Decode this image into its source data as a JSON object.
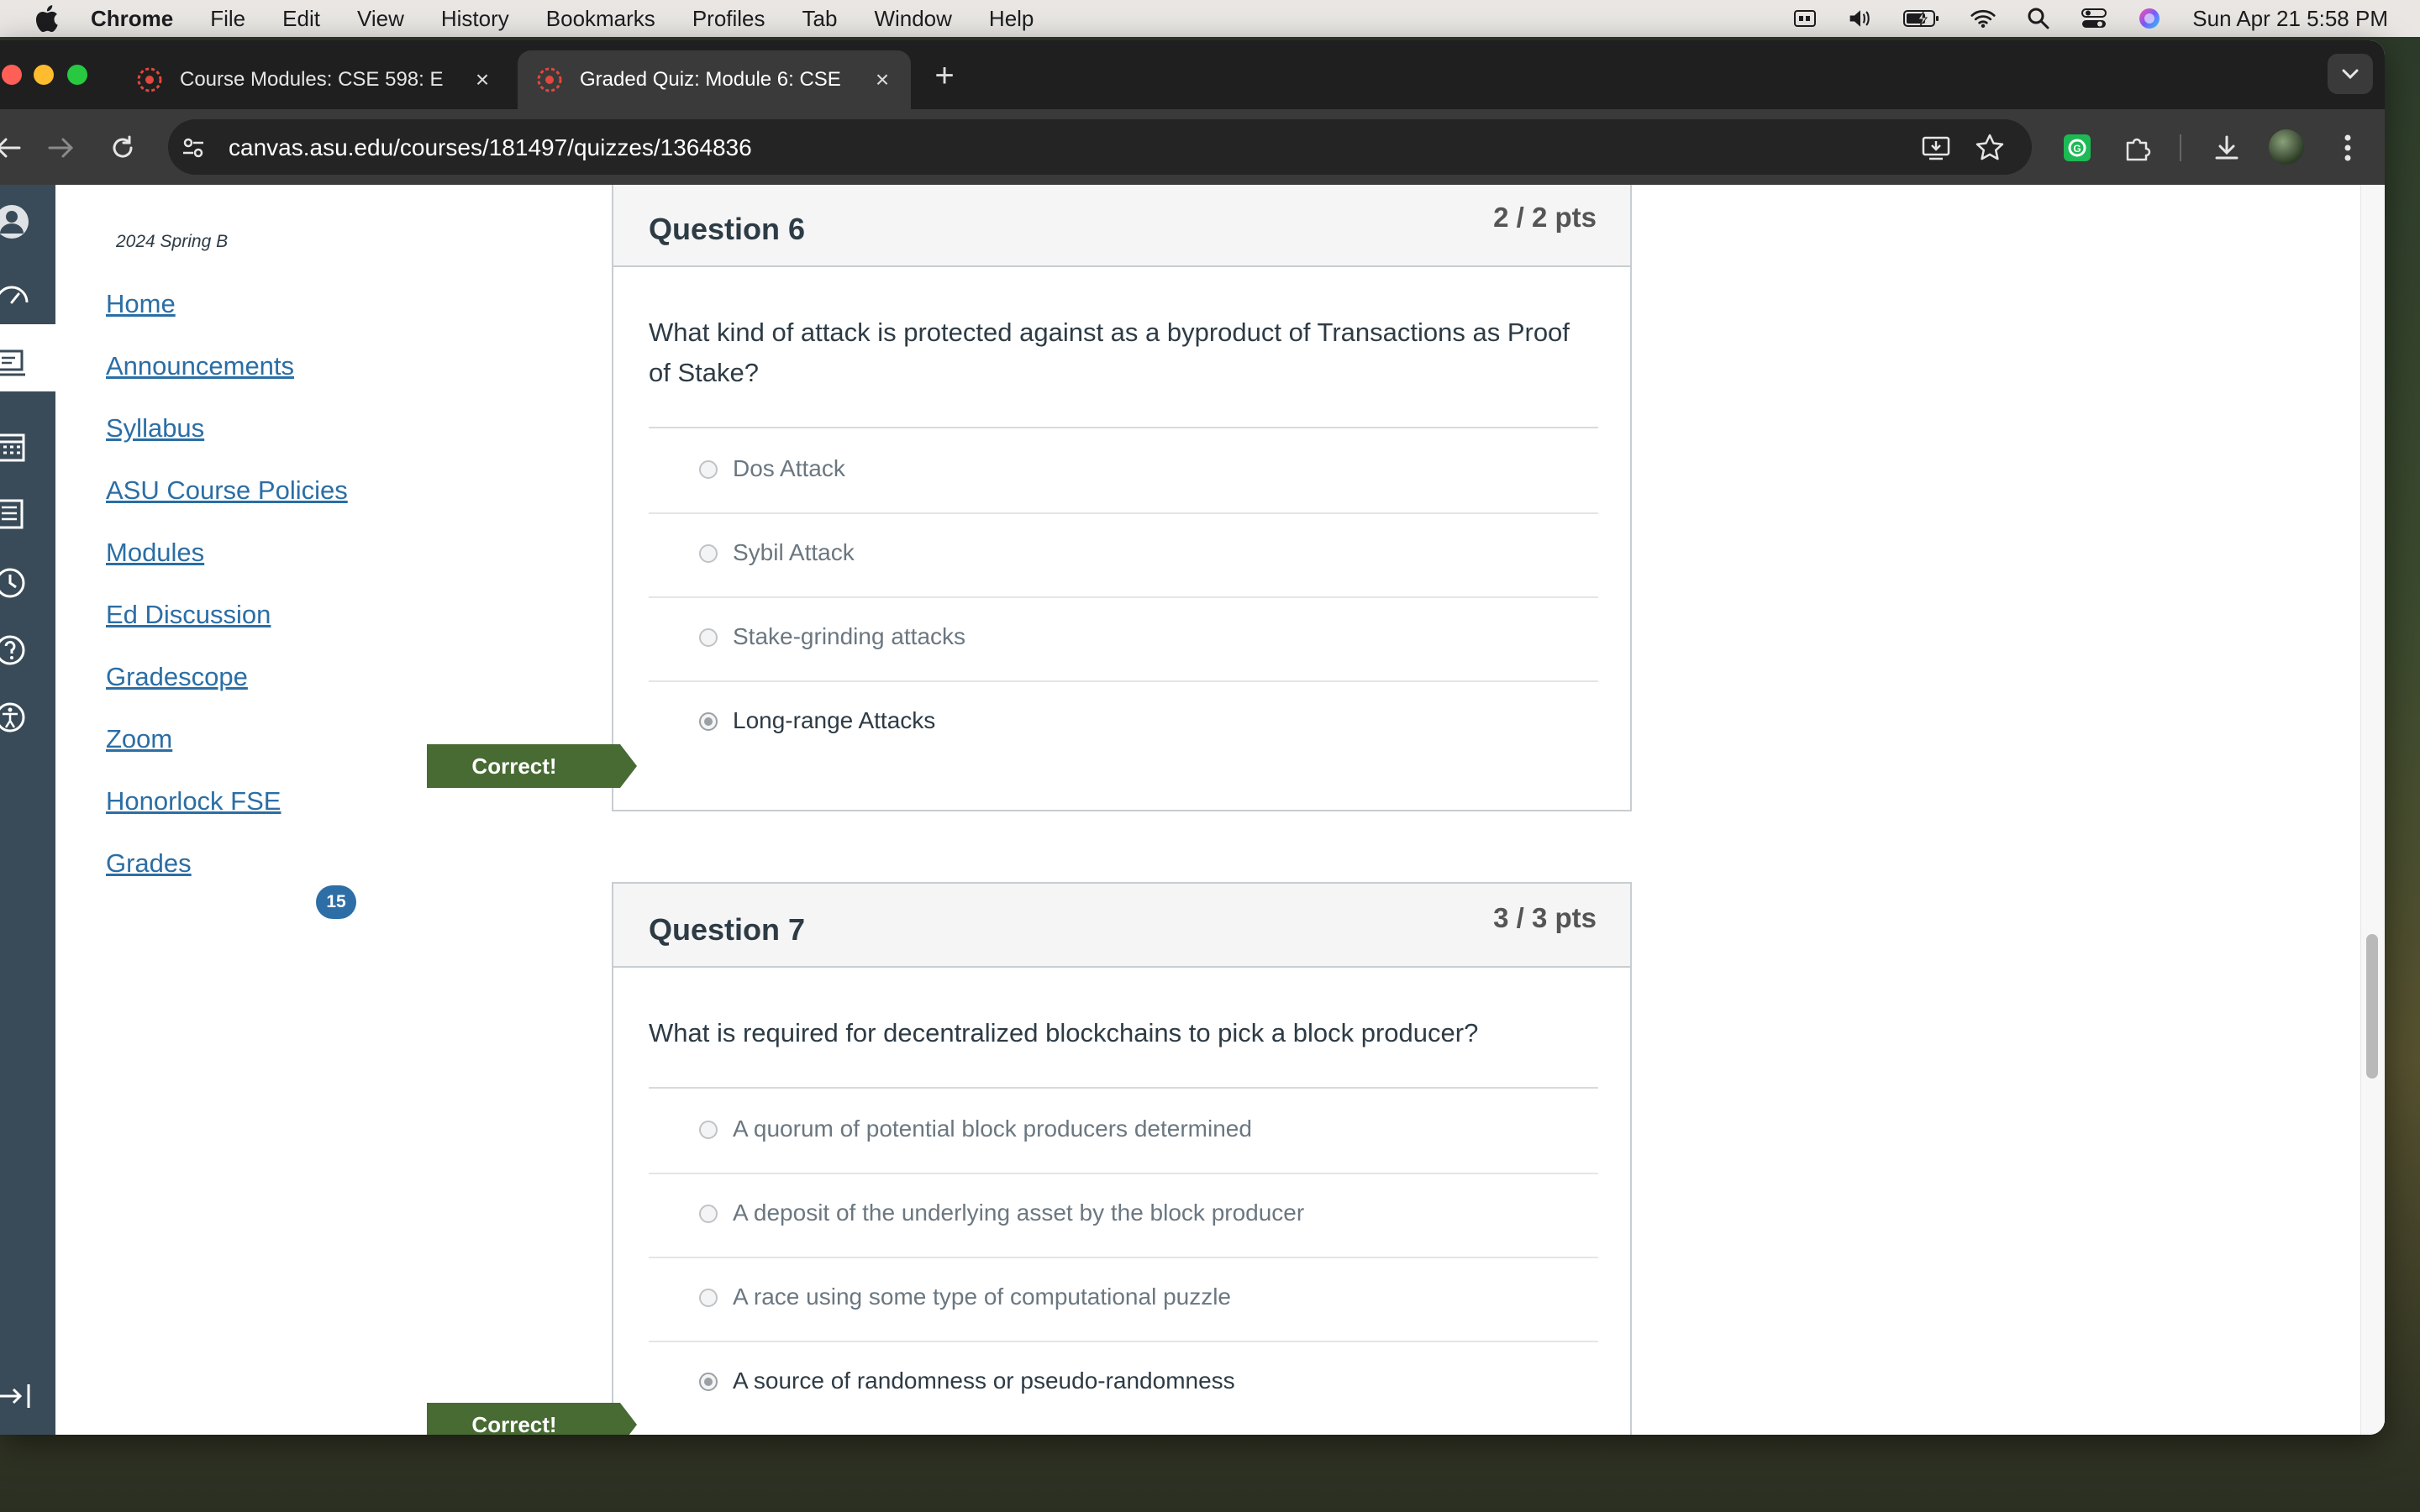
{
  "menubar": {
    "app_name": "Chrome",
    "menus": [
      "File",
      "Edit",
      "View",
      "History",
      "Bookmarks",
      "Profiles",
      "Tab",
      "Window",
      "Help"
    ],
    "clock": "Sun Apr 21  5:58 PM"
  },
  "browser": {
    "tabs": [
      {
        "title": "Course Modules: CSE 598: E",
        "active": false
      },
      {
        "title": "Graded Quiz: Module 6: CSE",
        "active": true
      }
    ],
    "new_tab": "+",
    "url": "canvas.asu.edu/courses/181497/quizzes/1364836"
  },
  "course_nav": {
    "term": "2024 Spring B",
    "links": [
      "Home",
      "Announcements",
      "Syllabus",
      "ASU Course Policies",
      "Modules",
      "Ed Discussion",
      "Gradescope",
      "Zoom",
      "Honorlock FSE",
      "Grades"
    ],
    "grades_badge": "15"
  },
  "questions": [
    {
      "title": "Question 6",
      "points": "2 / 2 pts",
      "text": "What kind of attack is protected against as a byproduct of Transactions as Proof of Stake?",
      "answers": [
        {
          "text": "Dos Attack",
          "selected": false
        },
        {
          "text": "Sybil Attack",
          "selected": false
        },
        {
          "text": "Stake-grinding attacks",
          "selected": false
        },
        {
          "text": "Long-range Attacks",
          "selected": true
        }
      ],
      "flag": "Correct!"
    },
    {
      "title": "Question 7",
      "points": "3 / 3 pts",
      "text": "What is required for decentralized blockchains to pick a block producer?",
      "answers": [
        {
          "text": "A quorum of potential block producers determined",
          "selected": false
        },
        {
          "text": "A deposit of the underlying asset by the block producer",
          "selected": false
        },
        {
          "text": "A race using some type of computational puzzle",
          "selected": false
        },
        {
          "text": "A source of randomness or pseudo-randomness",
          "selected": true
        }
      ],
      "flag": "Correct!"
    }
  ]
}
